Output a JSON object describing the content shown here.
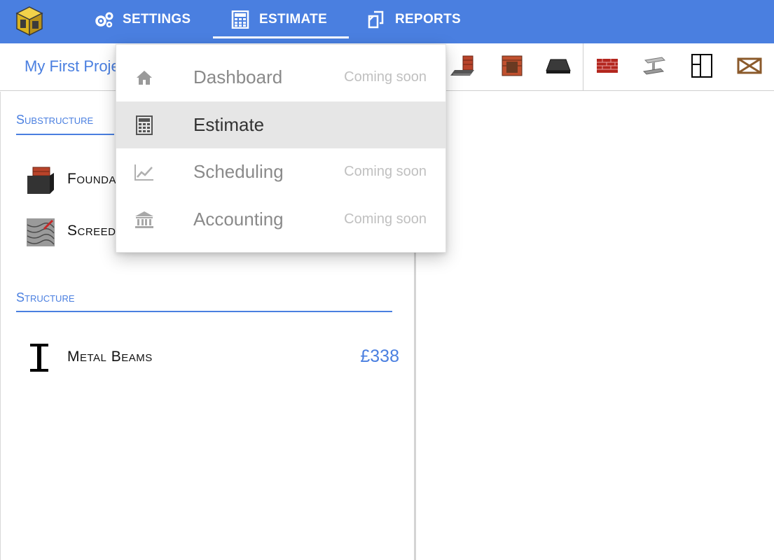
{
  "nav": {
    "logo_icon": "cube-logo-icon",
    "tabs": [
      {
        "label": "SETTINGS",
        "icon": "gears-icon"
      },
      {
        "label": "ESTIMATE",
        "icon": "calculator-icon"
      },
      {
        "label": "REPORTS",
        "icon": "documents-icon"
      }
    ],
    "active_tab": "ESTIMATE"
  },
  "subbar": {
    "project_title": "My First Project",
    "tools": [
      "brick-foundation-icon",
      "brick-pillar-icon",
      "slab-icon",
      "brick-wall-icon",
      "steel-beam-icon",
      "window-icon",
      "timber-frame-icon"
    ]
  },
  "sidebar": {
    "sections": [
      {
        "title": "Substructure",
        "items": [
          {
            "label": "Foundations",
            "icon": "foundation-block-icon"
          },
          {
            "label": "Screeding",
            "icon": "screed-trowel-icon"
          }
        ]
      },
      {
        "title": "Structure",
        "items": [
          {
            "label": "Metal Beams",
            "icon": "i-beam-icon",
            "cost": "£338"
          }
        ]
      }
    ]
  },
  "dropdown": {
    "items": [
      {
        "label": "Dashboard",
        "icon": "home-icon",
        "note": "Coming soon"
      },
      {
        "label": "Estimate",
        "icon": "calculator-icon",
        "note": ""
      },
      {
        "label": "Scheduling",
        "icon": "chart-line-icon",
        "note": "Coming soon"
      },
      {
        "label": "Accounting",
        "icon": "bank-icon",
        "note": "Coming soon"
      }
    ],
    "active_index": 1
  },
  "colors": {
    "accent": "#4a7fe0",
    "menu_active_bg": "#e6e6e6",
    "muted_text": "#8a8a8a"
  }
}
